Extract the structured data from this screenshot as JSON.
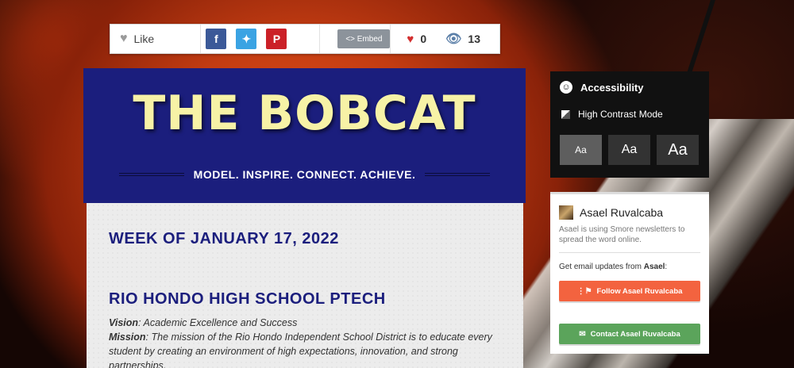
{
  "sharebar": {
    "like_label": "Like",
    "embed_label": "Embed",
    "hearts": "0",
    "views": "13"
  },
  "newsletter": {
    "title": "THE BOBCAT",
    "tagline": "MODEL. INSPIRE. CONNECT. ACHIEVE.",
    "week_heading": "WEEK OF JANUARY 17, 2022",
    "school_heading": "RIO HONDO HIGH SCHOOL PTECH",
    "vision_label": "Vision",
    "vision_text": ": Academic Excellence and Success",
    "mission_label": "Mission",
    "mission_text": ": The mission of the Rio Hondo Independent School District is to educate every student by creating an environment of high expectations, innovation, and strong partnerships."
  },
  "accessibility": {
    "heading": "Accessibility",
    "high_contrast": "High Contrast Mode",
    "sizes": [
      "Aa",
      "Aa",
      "Aa"
    ]
  },
  "author": {
    "name": "Asael Ruvalcaba",
    "description": "Asael is using Smore newsletters to spread the word online.",
    "updates_prefix": "Get email updates from ",
    "updates_name": "Asael",
    "updates_suffix": ":",
    "follow_label": "Follow Asael Ruvalcaba",
    "contact_label": "Contact Asael Ruvalcaba"
  },
  "colors": {
    "header_bg": "#1b1e7d",
    "title_color": "#f7f2a6",
    "follow": "#f3633f",
    "contact": "#5ba45b"
  }
}
